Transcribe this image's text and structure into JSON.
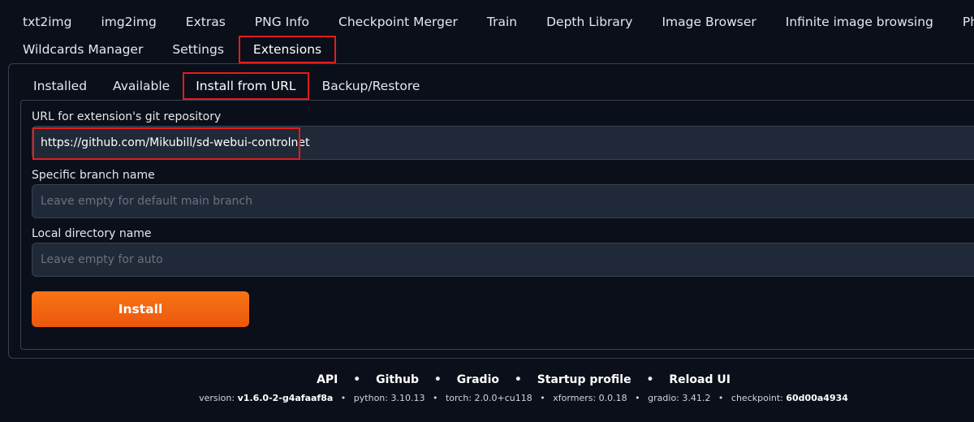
{
  "top_tabs": {
    "row1": [
      "txt2img",
      "img2img",
      "Extras",
      "PNG Info",
      "Checkpoint Merger",
      "Train",
      "Depth Library",
      "Image Browser",
      "Infinite image browsing",
      "Photopea"
    ],
    "row2": [
      "Wildcards Manager",
      "Settings",
      "Extensions"
    ],
    "active": "Extensions"
  },
  "extension_tabs": {
    "items": [
      "Installed",
      "Available",
      "Install from URL",
      "Backup/Restore"
    ],
    "active": "Install from URL"
  },
  "form": {
    "url_label": "URL for extension's git repository",
    "url_value": "https://github.com/Mikubill/sd-webui-controlnet",
    "branch_label": "Specific branch name",
    "branch_placeholder": "Leave empty for default main branch",
    "dir_label": "Local directory name",
    "dir_placeholder": "Leave empty for auto",
    "install_label": "Install"
  },
  "footer": {
    "links": [
      "API",
      "Github",
      "Gradio",
      "Startup profile",
      "Reload UI"
    ],
    "separator": "•",
    "version_label": "version:",
    "version": "v1.6.0-2-g4afaaf8a",
    "python_label": "python:",
    "python": "3.10.13",
    "torch_label": "torch:",
    "torch": "2.0.0+cu118",
    "xformers_label": "xformers:",
    "xformers": "0.0.18",
    "gradio_label": "gradio:",
    "gradio": "3.41.2",
    "checkpoint_label": "checkpoint:",
    "checkpoint": "60d00a4934"
  },
  "colors": {
    "background": "#0b0f19",
    "input_bg": "#1f2937",
    "border": "#374151",
    "accent": "#f97316",
    "highlight": "#e11d1d"
  }
}
